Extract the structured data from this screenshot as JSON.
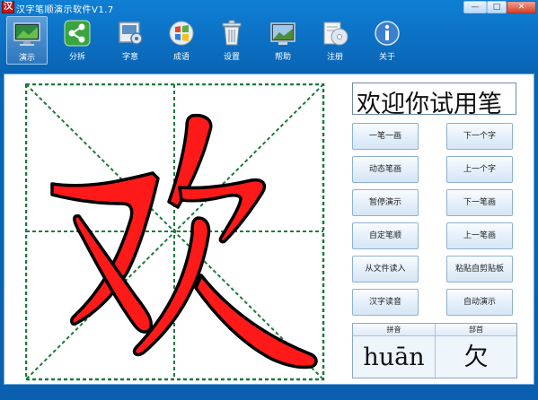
{
  "window": {
    "title": "汉字笔顺演示软件V1.7",
    "icon_glyph": "汉",
    "minimize_glyph": "—",
    "maximize_glyph": "□",
    "close_glyph": "✕"
  },
  "toolbar": {
    "items": [
      {
        "label": "演示",
        "icon": "monitor-icon",
        "active": true
      },
      {
        "label": "分拆",
        "icon": "share-icon",
        "active": false
      },
      {
        "label": "字意",
        "icon": "dictionary-icon",
        "active": false
      },
      {
        "label": "成语",
        "icon": "windows-logo-icon",
        "active": false
      },
      {
        "label": "设置",
        "icon": "trash-icon",
        "active": false
      },
      {
        "label": "帮助",
        "icon": "screen-icon",
        "active": false
      },
      {
        "label": "注册",
        "icon": "cd-icon",
        "active": false
      },
      {
        "label": "关于",
        "icon": "info-icon",
        "active": false
      }
    ]
  },
  "demo": {
    "character": "欢",
    "stroke_color": "#ff1a1a",
    "grid_color": "#1d7a3c"
  },
  "marquee": {
    "text": "欢迎你试用笔"
  },
  "buttons": {
    "one_stroke": "一笔一画",
    "next_char": "下一个字",
    "dynamic_strokes": "动态笔画",
    "prev_char": "上一个字",
    "pause": "暂停演示",
    "next_stroke": "下一笔画",
    "custom_order": "自定笔顺",
    "prev_stroke": "上一笔画",
    "read_file": "从文件读入",
    "paste_clipboard": "粘贴自剪贴板",
    "read_aloud": "汉字读音",
    "auto_demo": "自动演示"
  },
  "info": {
    "pinyin_header": "拼音",
    "radical_header": "部首",
    "pinyin": "huān",
    "radical": "欠"
  }
}
